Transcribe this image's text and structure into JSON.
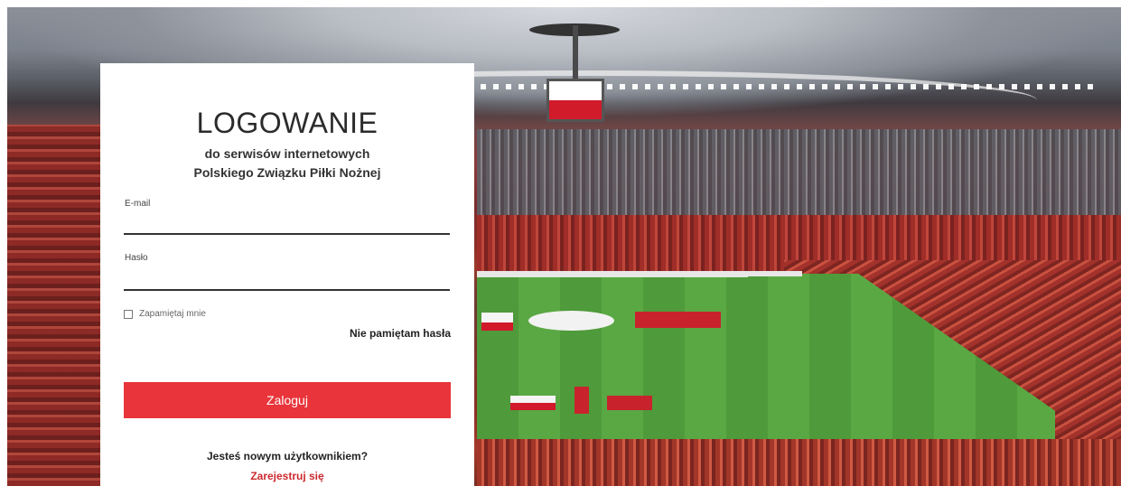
{
  "login": {
    "title": "LOGOWANIE",
    "subtitle_line1": "do serwisów internetowych",
    "subtitle_line2": "Polskiego Związku Piłki Nożnej",
    "email_label": "E-mail",
    "email_value": "",
    "password_label": "Hasło",
    "password_value": "",
    "remember_label": "Zapamiętaj mnie",
    "remember_checked": false,
    "forgot_label": "Nie pamiętam hasła",
    "submit_label": "Zaloguj",
    "new_user_text": "Jesteś nowym użytkownikiem?",
    "register_label": "Zarejestruj się"
  },
  "colors": {
    "accent": "#e8343a",
    "link": "#cc2a2f"
  },
  "background": {
    "icon": "stadium-image"
  }
}
